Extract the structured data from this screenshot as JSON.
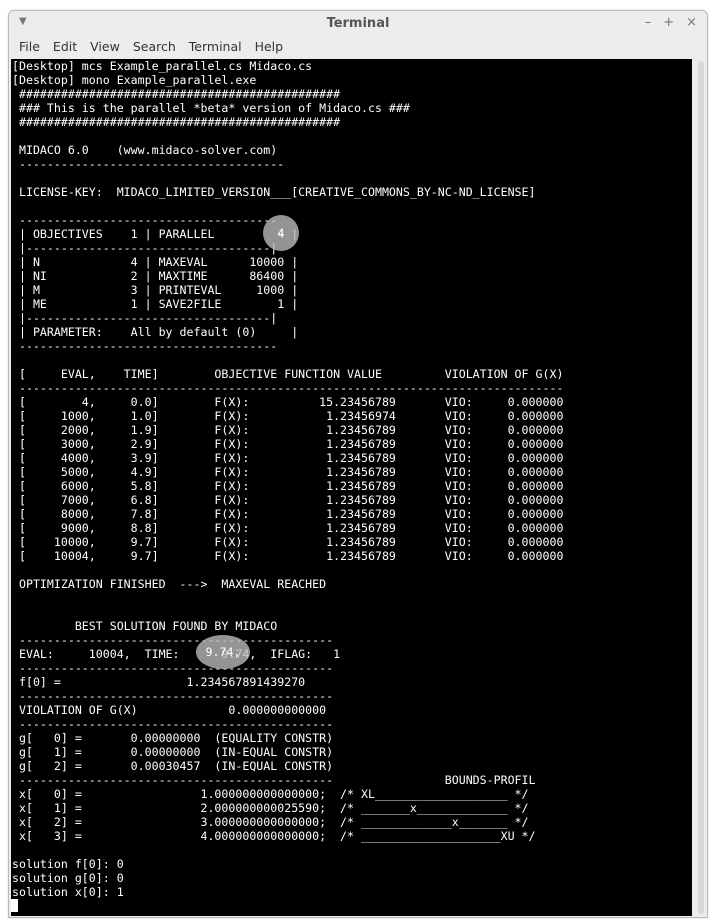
{
  "window": {
    "title": "Terminal",
    "controls": {
      "minimize": "–",
      "maximize": "+",
      "close": "×"
    }
  },
  "menubar": {
    "items": [
      "File",
      "Edit",
      "View",
      "Search",
      "Terminal",
      "Help"
    ]
  },
  "terminal": {
    "lines": [
      "[Desktop] mcs Example_parallel.cs Midaco.cs",
      "[Desktop] mono Example_parallel.exe",
      " ##############################################",
      " ### This is the parallel *beta* version of Midaco.cs ###",
      " ##############################################",
      "",
      " MIDACO 6.0    (www.midaco-solver.com)",
      " --------------------------------------",
      "",
      " LICENSE-KEY:  MIDACO_LIMITED_VERSION___[CREATIVE_COMMONS_BY-NC-ND_LICENSE]",
      "",
      " -------------------------------------",
      " | OBJECTIVES    1 | PARALLEL         4 |",
      " |-----------------------------------|",
      " | N             4 | MAXEVAL      10000 |",
      " | NI            2 | MAXTIME      86400 |",
      " | M             3 | PRINTEVAL     1000 |",
      " | ME            1 | SAVE2FILE        1 |",
      " |-----------------------------------|",
      " | PARAMETER:    All by default (0)     |",
      " -------------------------------------",
      "",
      " [     EVAL,    TIME]        OBJECTIVE FUNCTION VALUE         VIOLATION OF G(X)",
      " ------------------------------------------------------------------------------",
      " [        4,     0.0]        F(X):          15.23456789       VIO:     0.000000",
      " [     1000,     1.0]        F(X):           1.23456974       VIO:     0.000000",
      " [     2000,     1.9]        F(X):           1.23456789       VIO:     0.000000",
      " [     3000,     2.9]        F(X):           1.23456789       VIO:     0.000000",
      " [     4000,     3.9]        F(X):           1.23456789       VIO:     0.000000",
      " [     5000,     4.9]        F(X):           1.23456789       VIO:     0.000000",
      " [     6000,     5.8]        F(X):           1.23456789       VIO:     0.000000",
      " [     7000,     6.8]        F(X):           1.23456789       VIO:     0.000000",
      " [     8000,     7.8]        F(X):           1.23456789       VIO:     0.000000",
      " [     9000,     8.8]        F(X):           1.23456789       VIO:     0.000000",
      " [    10000,     9.7]        F(X):           1.23456789       VIO:     0.000000",
      " [    10004,     9.7]        F(X):           1.23456789       VIO:     0.000000",
      "",
      " OPTIMIZATION FINISHED  --->  MAXEVAL REACHED",
      "",
      "",
      "         BEST SOLUTION FOUND BY MIDACO",
      " ---------------------------------------------",
      " EVAL:     10004,  TIME:      9.74,  IFLAG:   1",
      " ---------------------------------------------",
      " f[0] =                  1.234567891439270",
      " ---------------------------------------------",
      " VIOLATION OF G(X)             0.000000000000",
      " ---------------------------------------------",
      " g[   0] =       0.00000000  (EQUALITY CONSTR)",
      " g[   1] =       0.00000000  (IN-EQUAL CONSTR)",
      " g[   2] =       0.00030457  (IN-EQUAL CONSTR)",
      " ---------------------------------------------                BOUNDS-PROFIL",
      " x[   0] =                 1.000000000000000;  /* XL___________________ */",
      " x[   1] =                 2.000000000025590;  /* _______x_____________ */",
      " x[   2] =                 3.000000000000000;  /* _____________x_______ */",
      " x[   3] =                 4.000000000000000;  /* ____________________XU */",
      "",
      "solution f[0]: 0",
      "solution g[0]: 0",
      "solution x[0]: 1"
    ]
  },
  "highlights": {
    "parallel_value": "4",
    "time_value": "9.74,"
  }
}
